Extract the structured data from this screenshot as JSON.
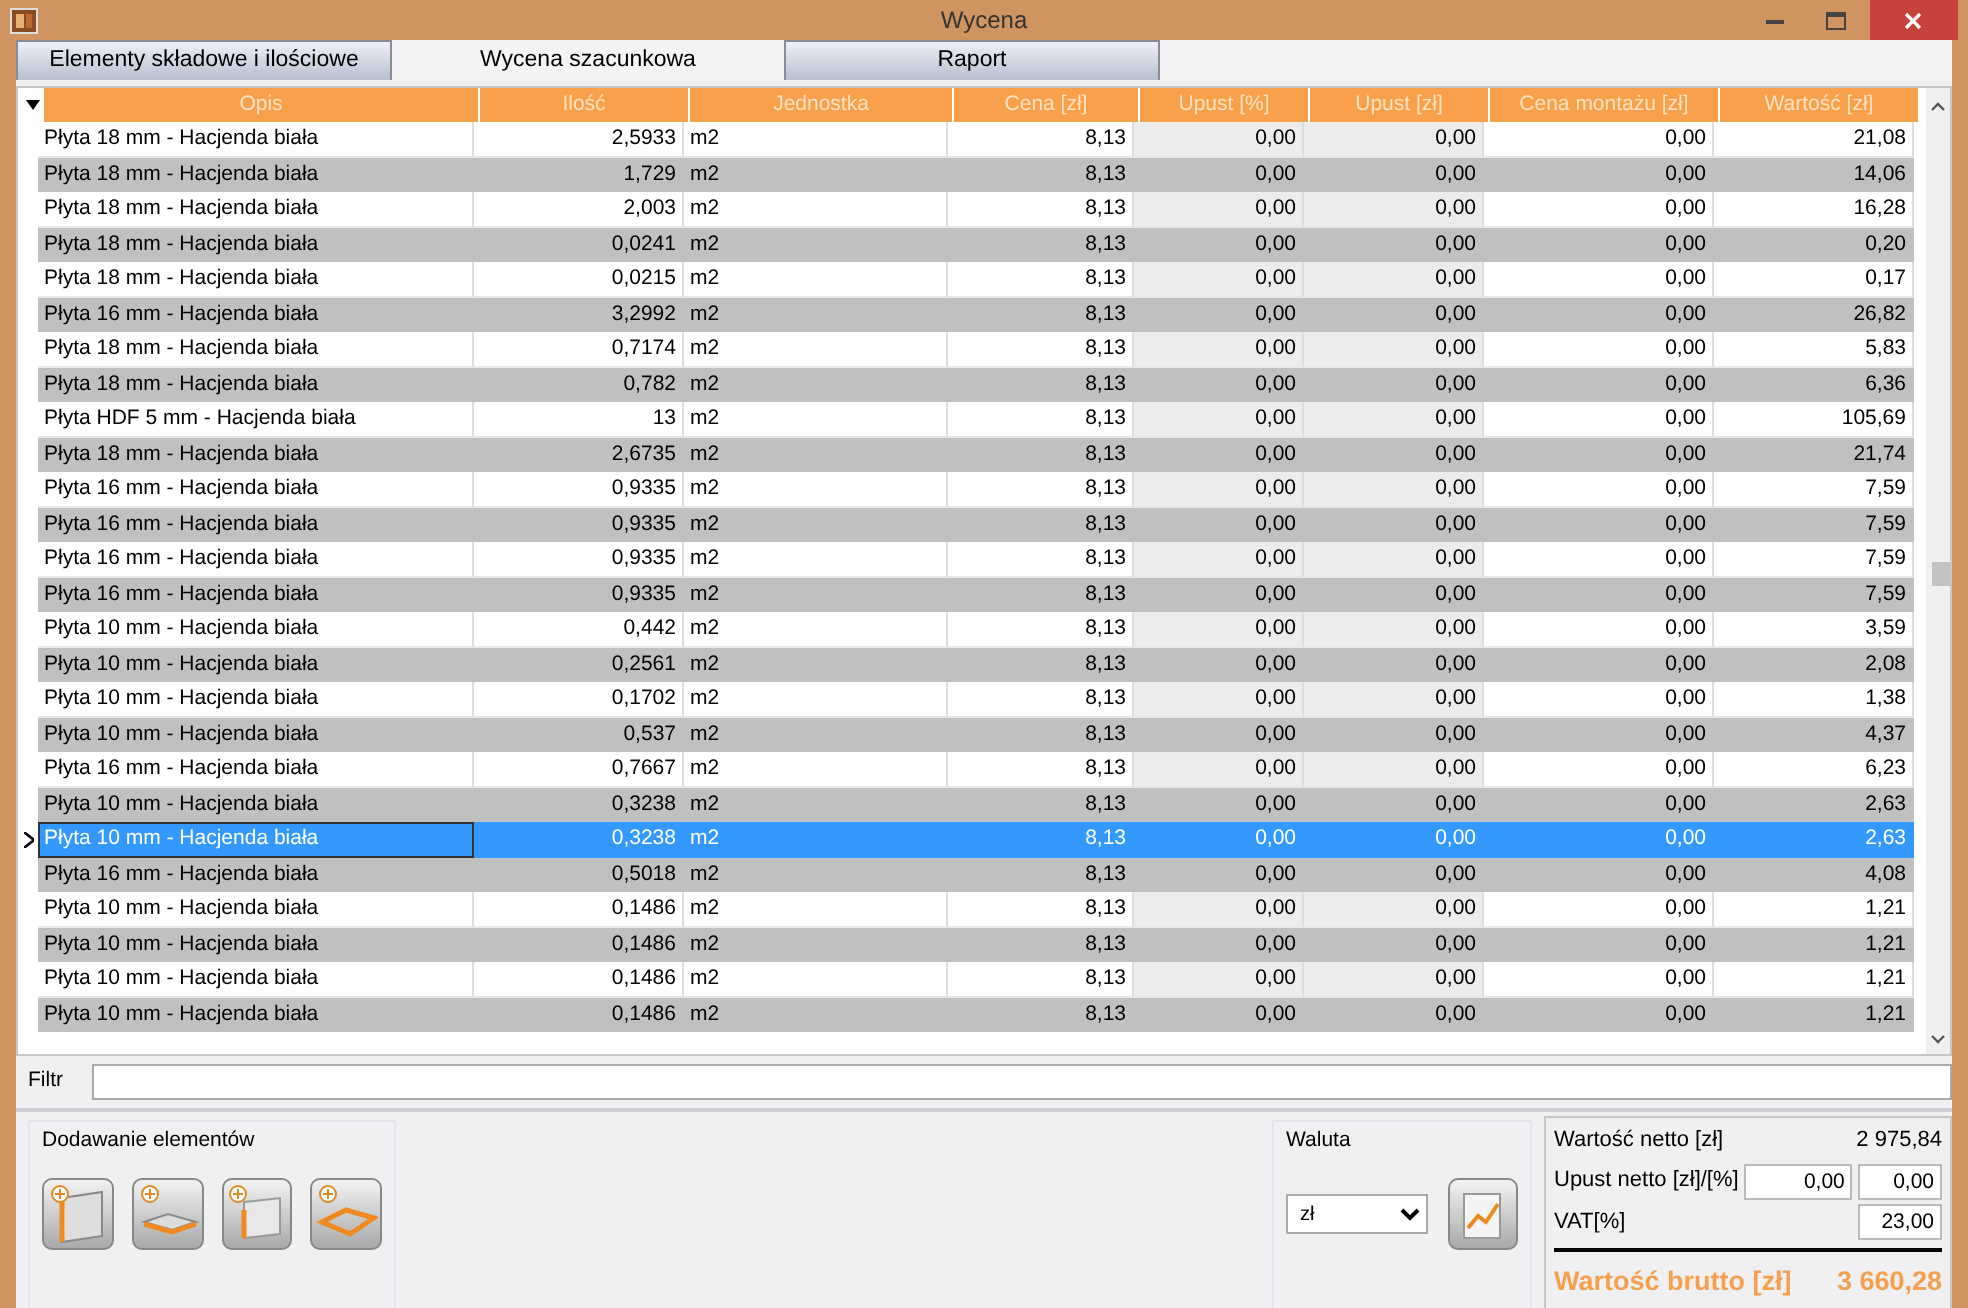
{
  "window": {
    "title": "Wycena"
  },
  "tabs": [
    {
      "label": "Elementy składowe i ilościowe",
      "selected": false
    },
    {
      "label": "Wycena szacunkowa",
      "selected": true
    },
    {
      "label": "Raport",
      "selected": false
    }
  ],
  "table": {
    "columns": [
      "Opis",
      "Ilość",
      "Jednostka",
      "Cena [zł]",
      "Upust [%]",
      "Upust [zł]",
      "Cena montażu [zł]",
      "Wartość [zł]"
    ],
    "rows": [
      {
        "cells": [
          "Płyta 18 mm - Hacjenda biała",
          "2,5933",
          "m2",
          "8,13",
          "0,00",
          "0,00",
          "0,00",
          "21,08"
        ],
        "selected": false
      },
      {
        "cells": [
          "Płyta 18 mm - Hacjenda biała",
          "1,729",
          "m2",
          "8,13",
          "0,00",
          "0,00",
          "0,00",
          "14,06"
        ],
        "selected": false
      },
      {
        "cells": [
          "Płyta 18 mm - Hacjenda biała",
          "2,003",
          "m2",
          "8,13",
          "0,00",
          "0,00",
          "0,00",
          "16,28"
        ],
        "selected": false
      },
      {
        "cells": [
          "Płyta 18 mm - Hacjenda biała",
          "0,0241",
          "m2",
          "8,13",
          "0,00",
          "0,00",
          "0,00",
          "0,20"
        ],
        "selected": false
      },
      {
        "cells": [
          "Płyta 18 mm - Hacjenda biała",
          "0,0215",
          "m2",
          "8,13",
          "0,00",
          "0,00",
          "0,00",
          "0,17"
        ],
        "selected": false
      },
      {
        "cells": [
          "Płyta 16 mm - Hacjenda biała",
          "3,2992",
          "m2",
          "8,13",
          "0,00",
          "0,00",
          "0,00",
          "26,82"
        ],
        "selected": false
      },
      {
        "cells": [
          "Płyta 18 mm - Hacjenda biała",
          "0,7174",
          "m2",
          "8,13",
          "0,00",
          "0,00",
          "0,00",
          "5,83"
        ],
        "selected": false
      },
      {
        "cells": [
          "Płyta 18 mm - Hacjenda biała",
          "0,782",
          "m2",
          "8,13",
          "0,00",
          "0,00",
          "0,00",
          "6,36"
        ],
        "selected": false
      },
      {
        "cells": [
          "Płyta HDF 5 mm - Hacjenda biała",
          "13",
          "m2",
          "8,13",
          "0,00",
          "0,00",
          "0,00",
          "105,69"
        ],
        "selected": false
      },
      {
        "cells": [
          "Płyta 18 mm - Hacjenda biała",
          "2,6735",
          "m2",
          "8,13",
          "0,00",
          "0,00",
          "0,00",
          "21,74"
        ],
        "selected": false
      },
      {
        "cells": [
          "Płyta 16 mm - Hacjenda biała",
          "0,9335",
          "m2",
          "8,13",
          "0,00",
          "0,00",
          "0,00",
          "7,59"
        ],
        "selected": false
      },
      {
        "cells": [
          "Płyta 16 mm - Hacjenda biała",
          "0,9335",
          "m2",
          "8,13",
          "0,00",
          "0,00",
          "0,00",
          "7,59"
        ],
        "selected": false
      },
      {
        "cells": [
          "Płyta 16 mm - Hacjenda biała",
          "0,9335",
          "m2",
          "8,13",
          "0,00",
          "0,00",
          "0,00",
          "7,59"
        ],
        "selected": false
      },
      {
        "cells": [
          "Płyta 16 mm - Hacjenda biała",
          "0,9335",
          "m2",
          "8,13",
          "0,00",
          "0,00",
          "0,00",
          "7,59"
        ],
        "selected": false
      },
      {
        "cells": [
          "Płyta 10 mm - Hacjenda biała",
          "0,442",
          "m2",
          "8,13",
          "0,00",
          "0,00",
          "0,00",
          "3,59"
        ],
        "selected": false
      },
      {
        "cells": [
          "Płyta 10 mm - Hacjenda biała",
          "0,2561",
          "m2",
          "8,13",
          "0,00",
          "0,00",
          "0,00",
          "2,08"
        ],
        "selected": false
      },
      {
        "cells": [
          "Płyta 10 mm - Hacjenda biała",
          "0,1702",
          "m2",
          "8,13",
          "0,00",
          "0,00",
          "0,00",
          "1,38"
        ],
        "selected": false
      },
      {
        "cells": [
          "Płyta 10 mm - Hacjenda biała",
          "0,537",
          "m2",
          "8,13",
          "0,00",
          "0,00",
          "0,00",
          "4,37"
        ],
        "selected": false
      },
      {
        "cells": [
          "Płyta 16 mm - Hacjenda biała",
          "0,7667",
          "m2",
          "8,13",
          "0,00",
          "0,00",
          "0,00",
          "6,23"
        ],
        "selected": false
      },
      {
        "cells": [
          "Płyta 10 mm - Hacjenda biała",
          "0,3238",
          "m2",
          "8,13",
          "0,00",
          "0,00",
          "0,00",
          "2,63"
        ],
        "selected": false
      },
      {
        "cells": [
          "Płyta 10 mm - Hacjenda biała",
          "0,3238",
          "m2",
          "8,13",
          "0,00",
          "0,00",
          "0,00",
          "2,63"
        ],
        "selected": true
      },
      {
        "cells": [
          "Płyta 16 mm - Hacjenda biała",
          "0,5018",
          "m2",
          "8,13",
          "0,00",
          "0,00",
          "0,00",
          "4,08"
        ],
        "selected": false
      },
      {
        "cells": [
          "Płyta 10 mm - Hacjenda biała",
          "0,1486",
          "m2",
          "8,13",
          "0,00",
          "0,00",
          "0,00",
          "1,21"
        ],
        "selected": false
      },
      {
        "cells": [
          "Płyta 10 mm - Hacjenda biała",
          "0,1486",
          "m2",
          "8,13",
          "0,00",
          "0,00",
          "0,00",
          "1,21"
        ],
        "selected": false
      },
      {
        "cells": [
          "Płyta 10 mm - Hacjenda biała",
          "0,1486",
          "m2",
          "8,13",
          "0,00",
          "0,00",
          "0,00",
          "1,21"
        ],
        "selected": false
      },
      {
        "cells": [
          "Płyta 10 mm - Hacjenda biała",
          "0,1486",
          "m2",
          "8,13",
          "0,00",
          "0,00",
          "0,00",
          "1,21"
        ],
        "selected": false
      }
    ]
  },
  "filter": {
    "label": "Filtr"
  },
  "adding": {
    "title": "Dodawanie elementów",
    "buttons": [
      {
        "kind": "side"
      },
      {
        "kind": "shelf"
      },
      {
        "kind": "back"
      },
      {
        "kind": "frame"
      }
    ]
  },
  "currency": {
    "title": "Waluta",
    "value": "zł"
  },
  "summary": {
    "net_label": "Wartość netto [zł]",
    "net_value": "2 975,84",
    "discount_label": "Upust netto [zł]/[%]",
    "discount_amount": "0,00",
    "discount_percent": "0,00",
    "vat_label": "VAT[%]",
    "vat_value": "23,00",
    "gross_label": "Wartość brutto [zł]",
    "gross_value": "3 660,28"
  }
}
